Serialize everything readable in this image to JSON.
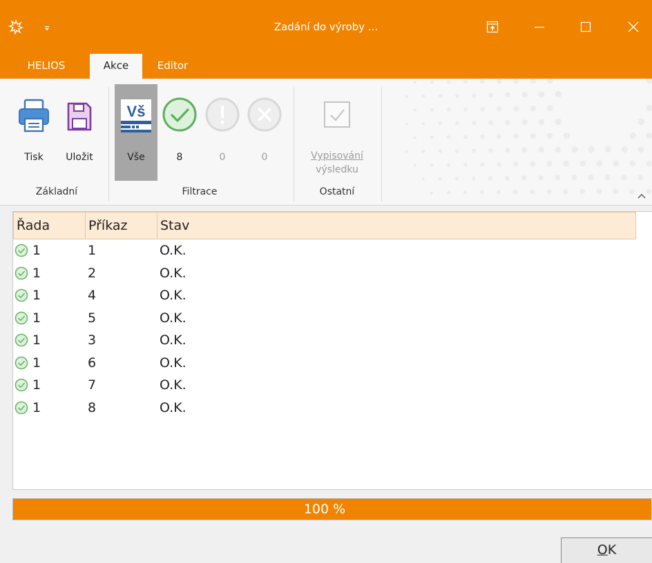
{
  "window": {
    "title": "Zadání do výroby ...",
    "accent_color": "#f08400"
  },
  "tabs": [
    {
      "label": "HELIOS",
      "active": false
    },
    {
      "label": "Akce",
      "active": true
    },
    {
      "label": "Editor",
      "active": false
    }
  ],
  "ribbon": {
    "groups": {
      "zakladni": "Základní",
      "filtrace": "Filtrace",
      "ostatni": "Ostatní"
    },
    "buttons": {
      "tisk": "Tisk",
      "ulozit": "Uložit",
      "vse": "Vše",
      "vse_icon_text": "Vš",
      "ok_count": "8",
      "warning_count": "0",
      "error_count": "0",
      "vypisovani_line1": "Vypisování",
      "vypisovani_line2": "výsledku"
    }
  },
  "grid": {
    "columns": [
      "Řada",
      "Příkaz",
      "Stav"
    ],
    "rows": [
      {
        "rada": "1",
        "prikaz": "1",
        "stav": "O.K.",
        "icon": "check-circle-icon"
      },
      {
        "rada": "1",
        "prikaz": "2",
        "stav": "O.K.",
        "icon": "check-circle-icon"
      },
      {
        "rada": "1",
        "prikaz": "4",
        "stav": "O.K.",
        "icon": "check-circle-icon"
      },
      {
        "rada": "1",
        "prikaz": "5",
        "stav": "O.K.",
        "icon": "check-circle-icon"
      },
      {
        "rada": "1",
        "prikaz": "3",
        "stav": "O.K.",
        "icon": "check-circle-icon"
      },
      {
        "rada": "1",
        "prikaz": "6",
        "stav": "O.K.",
        "icon": "check-circle-icon"
      },
      {
        "rada": "1",
        "prikaz": "7",
        "stav": "O.K.",
        "icon": "check-circle-icon"
      },
      {
        "rada": "1",
        "prikaz": "8",
        "stav": "O.K.",
        "icon": "check-circle-icon"
      }
    ]
  },
  "progress": {
    "value": 1.0,
    "label": "100 %"
  },
  "ok_button": {
    "label": "OK"
  }
}
